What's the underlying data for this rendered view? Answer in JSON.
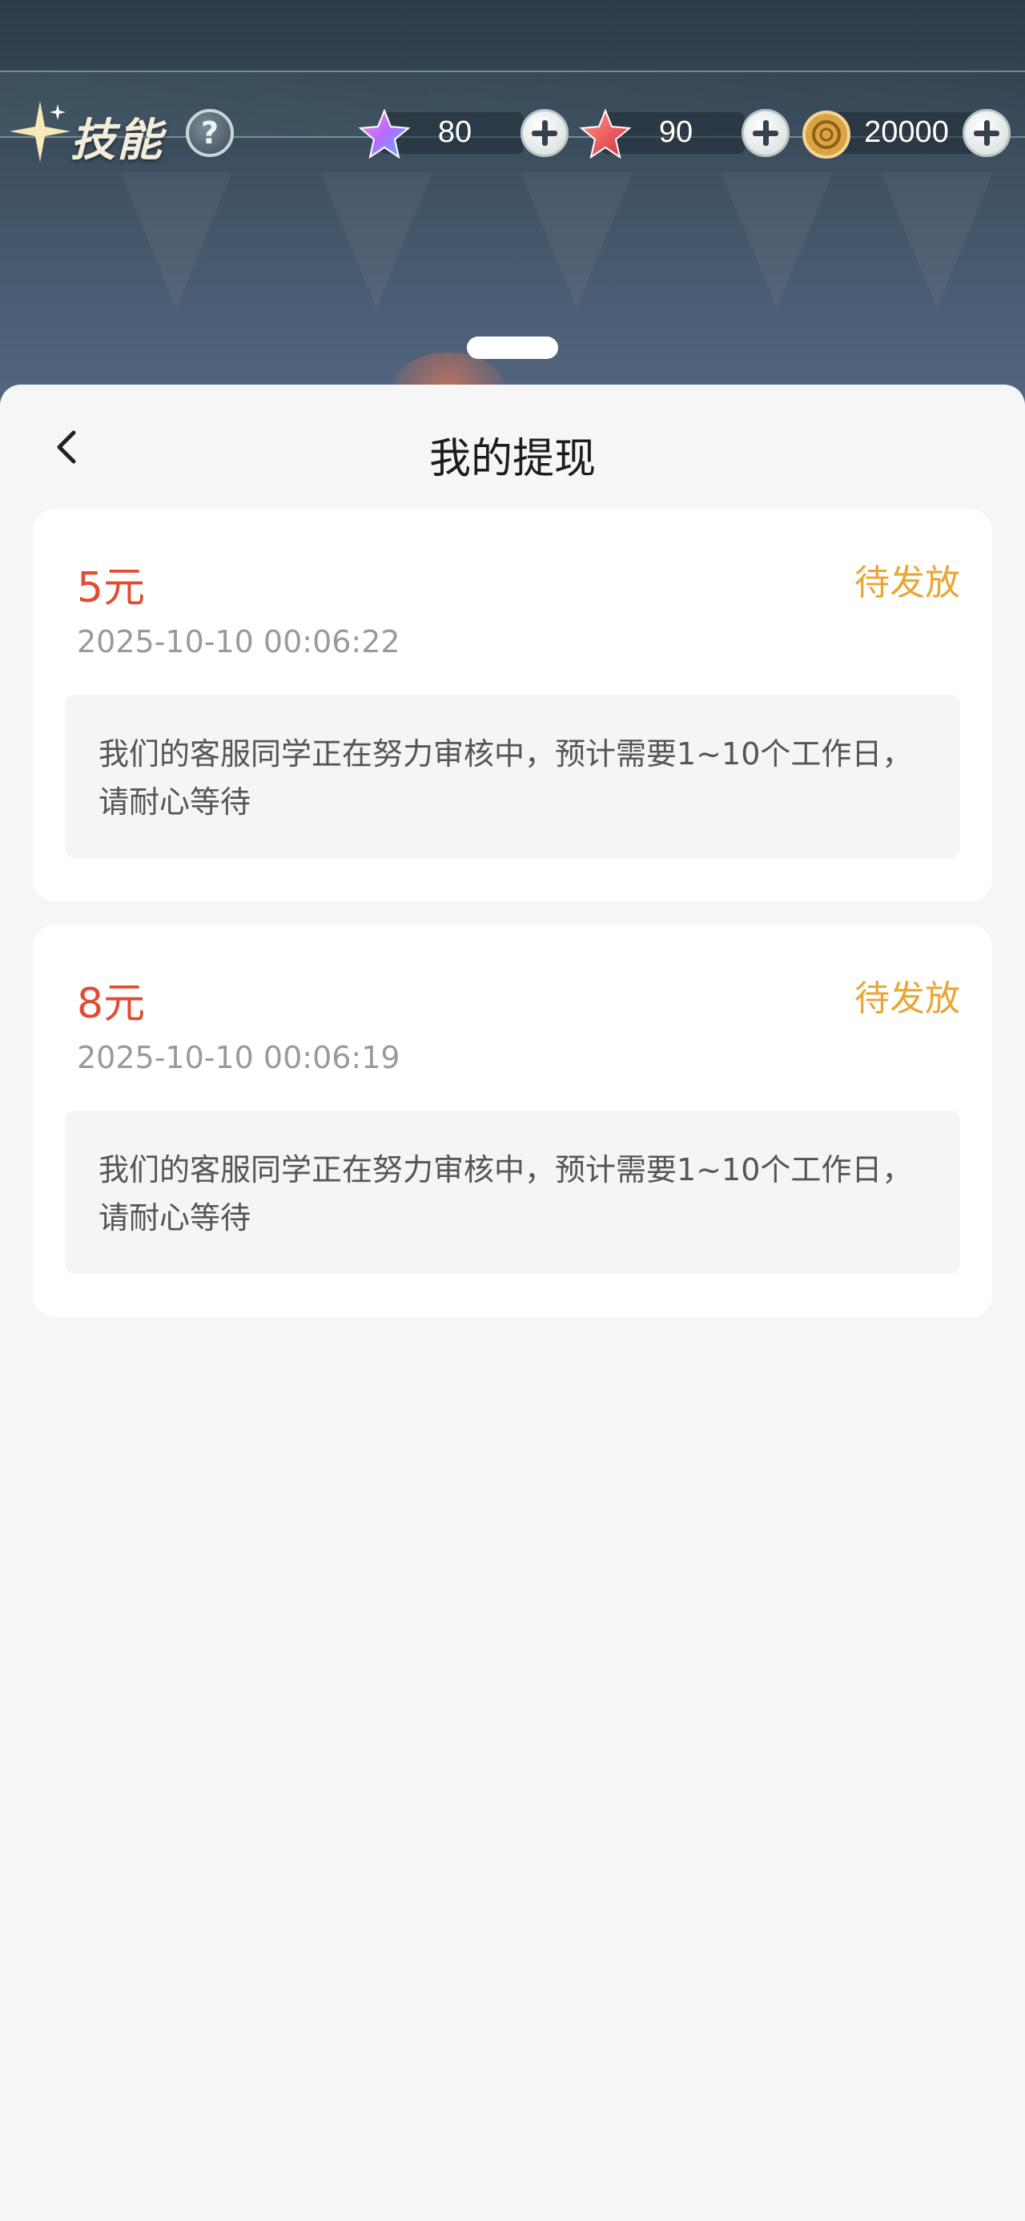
{
  "game_hud": {
    "skill_title": "技能",
    "help_label": "?",
    "currencies": [
      {
        "icon": "purple-star-icon",
        "value": "80"
      },
      {
        "icon": "red-star-icon",
        "value": "90"
      },
      {
        "icon": "gold-coin-icon",
        "value": "20000"
      }
    ]
  },
  "sheet": {
    "title": "我的提现",
    "withdrawals": [
      {
        "amount": "5元",
        "status": "待发放",
        "time": "2025-10-10 00:06:22",
        "note": "我们的客服同学正在努力审核中，预计需要1~10个工作日，请耐心等待"
      },
      {
        "amount": "8元",
        "status": "待发放",
        "time": "2025-10-10 00:06:19",
        "note": "我们的客服同学正在努力审核中，预计需要1~10个工作日，请耐心等待"
      }
    ]
  },
  "colors": {
    "amount": "#e04d35",
    "status": "#e9a734",
    "sheet_bg": "#f6f6f6"
  }
}
